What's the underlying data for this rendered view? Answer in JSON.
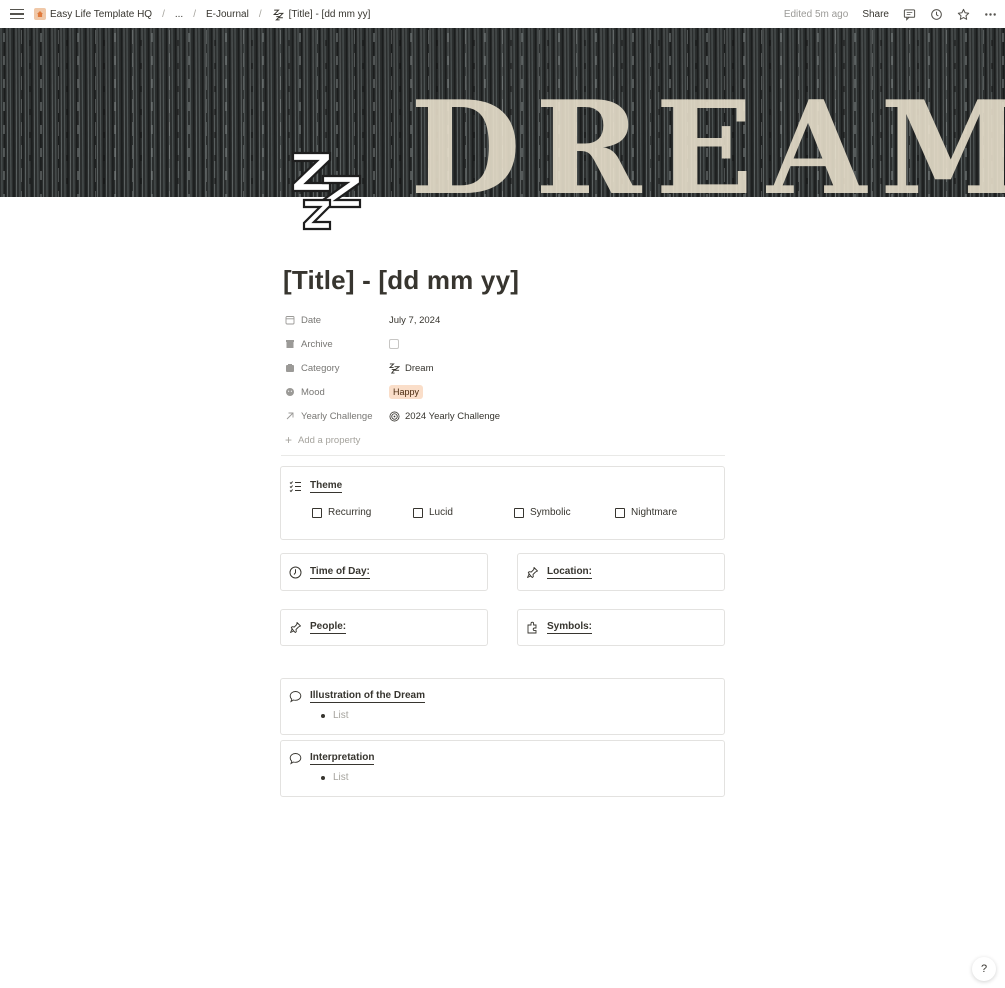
{
  "breadcrumb": {
    "workspace": "Easy Life Template HQ",
    "ellipsis": "...",
    "parent": "E-Journal",
    "current": "[Title] - [dd mm yy]"
  },
  "topbar": {
    "edited": "Edited 5m ago",
    "share": "Share"
  },
  "cover": {
    "word": "DREAM"
  },
  "page": {
    "title": "[Title] - [dd mm yy]"
  },
  "properties": {
    "date_label": "Date",
    "date_value": "July 7, 2024",
    "archive_label": "Archive",
    "category_label": "Category",
    "category_value": "Dream",
    "mood_label": "Mood",
    "mood_value": "Happy",
    "yearly_label": "Yearly Challenge",
    "yearly_value": "2024 Yearly Challenge",
    "add_property": "Add a property"
  },
  "theme": {
    "title": "Theme",
    "options": [
      "Recurring",
      "Lucid",
      "Symbolic",
      "Nightmare"
    ]
  },
  "fields": {
    "time_of_day": "Time of Day:",
    "location": "Location:",
    "people": "People:",
    "symbols": "Symbols:"
  },
  "illustration": {
    "title": "Illustration of the Dream",
    "placeholder": "List"
  },
  "interpretation": {
    "title": "Interpretation",
    "placeholder": "List"
  },
  "help": {
    "label": "?"
  },
  "colors": {
    "mood_pill_bg": "#fadec9",
    "text": "#37352f",
    "muted": "#787774"
  }
}
